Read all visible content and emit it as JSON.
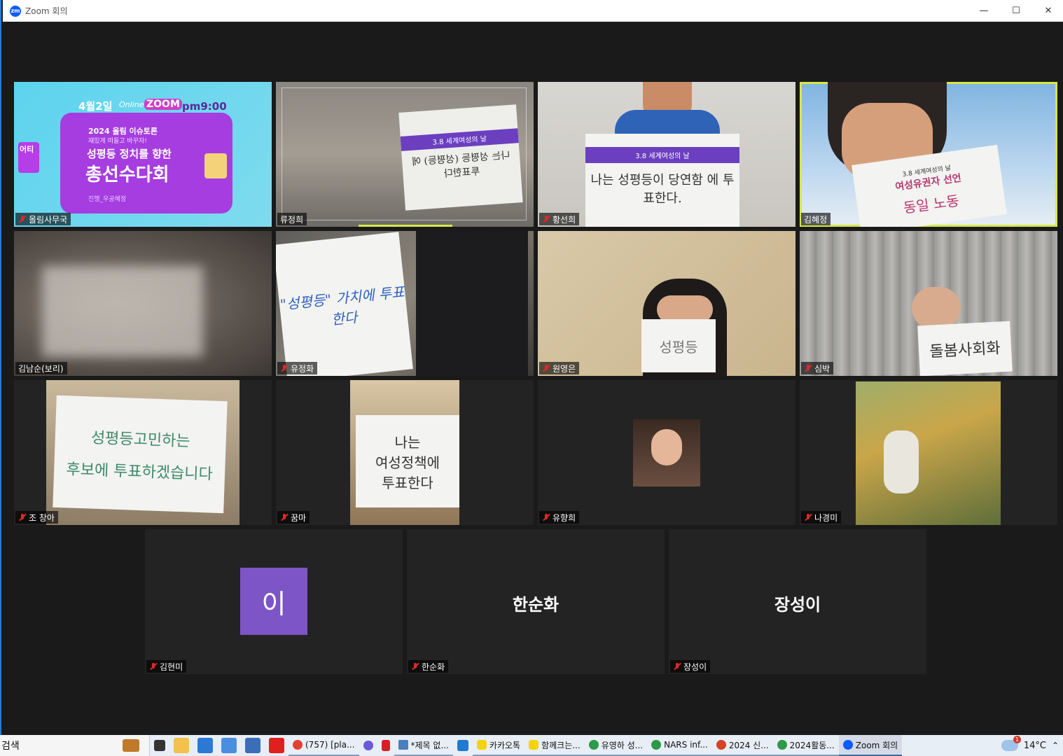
{
  "window": {
    "title": "Zoom 회의",
    "logo": "zm"
  },
  "controls": {
    "minimize": "—",
    "maximize": "☐",
    "close": "✕"
  },
  "poster": {
    "date": "4월2일",
    "online": "Online",
    "zoom": "ZOOM",
    "time": "pm9:00",
    "line1": "2024 올림 이슈토론",
    "line2": "재밌게 떠들고 바꾸자!",
    "line3": "성평등 정치를 향한",
    "line4": "총선수다회",
    "line5": "진행_우공혜정",
    "side": "어티"
  },
  "signs": {
    "s2_top": "3.8 세계여성의 날",
    "s2_main": "나는 성평등이 당연함 에 투표한다.",
    "s3_top": "3.8 세계여성의 날",
    "s3_title": "여성유권자 선언",
    "s3_main": "동일 노동",
    "s4": "\"성평등\" 가치에 투표한다",
    "s5": "성평등",
    "s6": "돌봄사회화",
    "s7a": "성평등고민하는",
    "s7b": "후보에 투표하겠습니다",
    "s8a": "나는",
    "s8b": "여성정책에",
    "s8c": "투표한다",
    "s1_main": "나는 성평등 (성평등) 에 투표한다"
  },
  "participants": [
    {
      "name": "올림사무국",
      "muted": true
    },
    {
      "name": "류정희",
      "muted": false
    },
    {
      "name": "황선희",
      "muted": true
    },
    {
      "name": "김혜정",
      "muted": false
    },
    {
      "name": "김남순(보리)",
      "muted": false
    },
    {
      "name": "유정화",
      "muted": true
    },
    {
      "name": "원영은",
      "muted": true
    },
    {
      "name": "심박",
      "muted": true
    },
    {
      "name": "조 창아",
      "muted": true
    },
    {
      "name": "꿈마",
      "muted": true
    },
    {
      "name": "유향희",
      "muted": true
    },
    {
      "name": "나경미",
      "muted": true
    },
    {
      "name": "김현미",
      "muted": true,
      "avatar_text": "이"
    },
    {
      "name": "한순화",
      "muted": true,
      "display_name": "한순화"
    },
    {
      "name": "장성이",
      "muted": true,
      "display_name": "장성이"
    }
  ],
  "taskbar": {
    "search": "검색",
    "items": [
      {
        "label": "(757) [pla...",
        "color": "#e34133"
      },
      {
        "label": "*제목 없...",
        "color": "#4a7fbf"
      },
      {
        "label": "카카오톡",
        "color": "#f5d30d"
      },
      {
        "label": "함께크는...",
        "color": "#f5d30d"
      },
      {
        "label": "유영하 성...",
        "color": "#2c9a48"
      },
      {
        "label": "NARS inf...",
        "color": "#2c9a48"
      },
      {
        "label": "2024 신...",
        "color": "#d14424"
      },
      {
        "label": "2024활동...",
        "color": "#2c9a48"
      },
      {
        "label": "Zoom 회의",
        "color": "#0b5cff"
      }
    ],
    "weather": "14°C",
    "badge": "1"
  }
}
